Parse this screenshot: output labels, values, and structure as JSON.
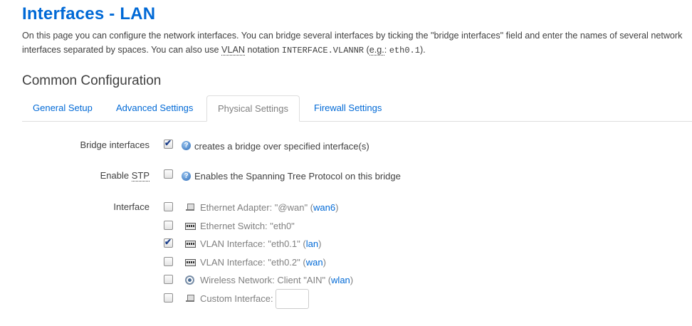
{
  "page": {
    "title": "Interfaces - LAN",
    "desc_part1": "On this page you can configure the network interfaces. You can bridge several interfaces by ticking the \"bridge interfaces\" field and enter the names of several network interfaces separated by spaces. You can also use ",
    "desc_vlan": "VLAN",
    "desc_part2": " notation ",
    "desc_code1": "INTERFACE.VLANNR",
    "desc_part3": " (",
    "desc_eg": "e.g.",
    "desc_part4": ": ",
    "desc_code2": "eth0.1",
    "desc_part5": ")."
  },
  "section": {
    "title": "Common Configuration"
  },
  "tabs": [
    {
      "label": "General Setup",
      "active": false
    },
    {
      "label": "Advanced Settings",
      "active": false
    },
    {
      "label": "Physical Settings",
      "active": true
    },
    {
      "label": "Firewall Settings",
      "active": false
    }
  ],
  "bridge": {
    "label": "Bridge interfaces",
    "checked": true,
    "help": "creates a bridge over specified interface(s)"
  },
  "stp": {
    "label_prefix": "Enable ",
    "label_abbr": "STP",
    "checked": false,
    "help": "Enables the Spanning Tree Protocol on this bridge"
  },
  "interface": {
    "label": "Interface",
    "items": [
      {
        "icon": "ethernet-adapter-icon",
        "text": "Ethernet Adapter: \"@wan\" (",
        "network": "wan6",
        "suffix": ")",
        "checked": false
      },
      {
        "icon": "ethernet-switch-icon",
        "text": "Ethernet Switch: \"eth0\"",
        "network": "",
        "suffix": "",
        "checked": false
      },
      {
        "icon": "ethernet-switch-icon",
        "text": "VLAN Interface: \"eth0.1\" (",
        "network": "lan",
        "suffix": ")",
        "checked": true
      },
      {
        "icon": "ethernet-switch-icon",
        "text": "VLAN Interface: \"eth0.2\" (",
        "network": "wan",
        "suffix": ")",
        "checked": false
      },
      {
        "icon": "wireless-icon",
        "text": "Wireless Network: Client \"AIN\" (",
        "network": "wlan",
        "suffix": ")",
        "checked": false
      },
      {
        "icon": "ethernet-adapter-icon",
        "text": "Custom Interface:",
        "network": "",
        "suffix": "",
        "checked": false,
        "input_value": ""
      }
    ]
  },
  "colors": {
    "link": "#0069d6",
    "text": "#404040",
    "muted": "#808080"
  }
}
